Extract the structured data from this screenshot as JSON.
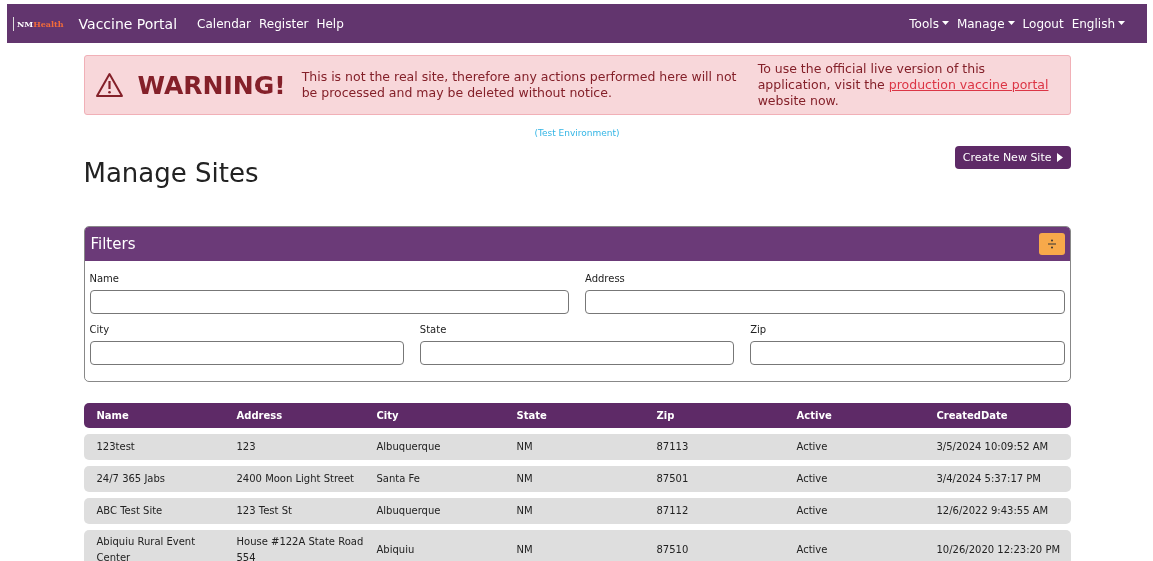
{
  "navbar": {
    "logo": {
      "mark": "NM",
      "word": "Health"
    },
    "brand": "Vaccine Portal",
    "links": [
      {
        "label": "Calendar"
      },
      {
        "label": "Register"
      },
      {
        "label": "Help"
      }
    ],
    "right_links": [
      {
        "label": "Tools",
        "dropdown": true
      },
      {
        "label": "Manage",
        "dropdown": true
      },
      {
        "label": "Logout",
        "dropdown": false
      },
      {
        "label": "English",
        "dropdown": true
      }
    ]
  },
  "warning": {
    "title": "WARNING!",
    "message": "This is not the real site, therefore any actions performed here will not be processed and may be deleted without notice.",
    "notice_before": "To use the official live version of this application, visit the ",
    "link": "production vaccine portal",
    "notice_after": " website now."
  },
  "environment": "(Test Environment)",
  "page_title": "Manage Sites",
  "create_button": "Create New Site",
  "filters": {
    "title": "Filters",
    "row_1": [
      {
        "label": "Name"
      },
      {
        "label": "Address"
      }
    ],
    "row_2": [
      {
        "label": "City"
      },
      {
        "label": "State"
      },
      {
        "label": "Zip"
      }
    ]
  },
  "table": {
    "columns": [
      "Name",
      "Address",
      "City",
      "State",
      "Zip",
      "Active",
      "CreatedDate"
    ],
    "rows": [
      [
        "123test",
        "123",
        "Albuquerque",
        "NM",
        "87113",
        "Active",
        "3/5/2024 10:09:52 AM"
      ],
      [
        "24/7 365 Jabs",
        "2400 Moon Light Street",
        "Santa Fe",
        "NM",
        "87501",
        "Active",
        "3/4/2024 5:37:17 PM"
      ],
      [
        "ABC Test Site",
        "123 Test St",
        "Albuquerque",
        "NM",
        "87112",
        "Active",
        "12/6/2022 9:43:55 AM"
      ],
      [
        "Abiquiu Rural Event Center",
        "House #122A State Road 554",
        "Abiquiu",
        "NM",
        "87510",
        "Active",
        "10/26/2020 12:23:20 PM"
      ]
    ]
  }
}
